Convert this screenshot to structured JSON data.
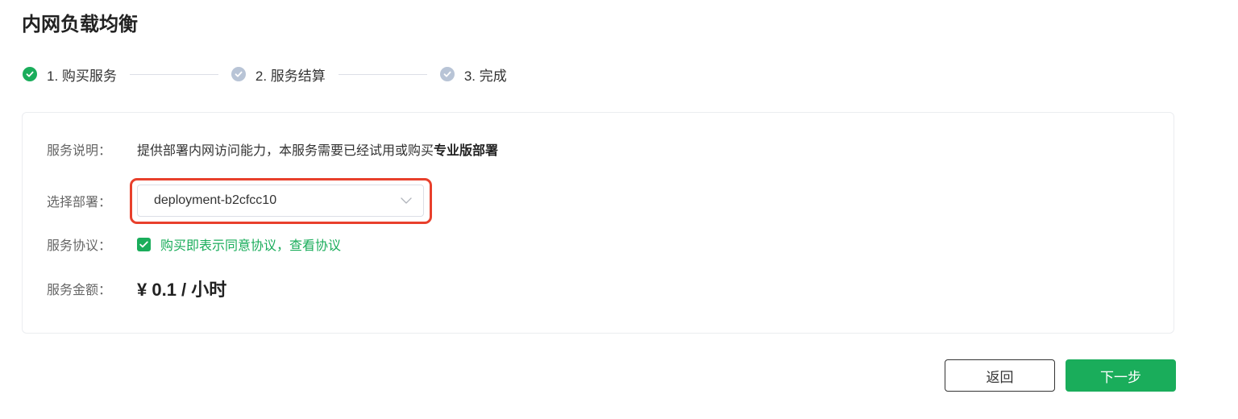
{
  "page": {
    "title": "内网负载均衡"
  },
  "steps": [
    {
      "label": "1. 购买服务",
      "status": "done",
      "icon": "check-circle-icon"
    },
    {
      "label": "2. 服务结算",
      "status": "pending",
      "icon": "check-circle-icon"
    },
    {
      "label": "3. 完成",
      "status": "pending",
      "icon": "check-circle-icon"
    }
  ],
  "colors": {
    "accent": "#1aad5b",
    "pending": "#b8c4d6",
    "highlight": "#e8402c"
  },
  "form": {
    "description": {
      "label": "服务说明：",
      "text": "提供部署内网访问能力，本服务需要已经试用或购买",
      "bold": "专业版部署"
    },
    "deployment": {
      "label": "选择部署：",
      "value": "deployment-b2cfcc10",
      "icon": "chevron-down-icon"
    },
    "agreement": {
      "label": "服务协议：",
      "checked": true,
      "text": "购买即表示同意协议，查看协议"
    },
    "price": {
      "label": "服务金额：",
      "value": "¥ 0.1 / 小时"
    }
  },
  "actions": {
    "back_label": "返回",
    "next_label": "下一步"
  }
}
